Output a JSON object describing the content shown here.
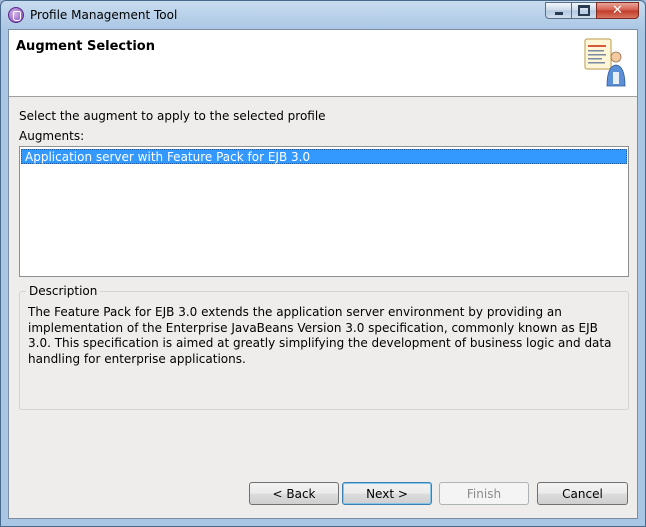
{
  "window": {
    "title": "Profile Management Tool"
  },
  "header": {
    "title": "Augment Selection"
  },
  "main": {
    "prompt": "Select the augment to apply to the selected profile",
    "augments_label": "Augments:",
    "augments": [
      {
        "label": "Application server with Feature Pack for EJB 3.0",
        "selected": true
      }
    ],
    "description": {
      "title": "Description",
      "text": "The Feature Pack for EJB 3.0 extends the application server environment by providing an implementation of the Enterprise JavaBeans Version 3.0 specification, commonly known as EJB 3.0. This specification is aimed at greatly simplifying the development of business logic and data handling for enterprise applications."
    }
  },
  "buttons": {
    "back": "< Back",
    "next": "Next >",
    "finish": "Finish",
    "cancel": "Cancel"
  },
  "colors": {
    "selection": "#3399ff",
    "title_bar": "#a9c6e4",
    "close_button": "#c23a2a"
  },
  "icons": {
    "app": "profile-tool-icon",
    "wizard": "wizard-banner-icon"
  }
}
